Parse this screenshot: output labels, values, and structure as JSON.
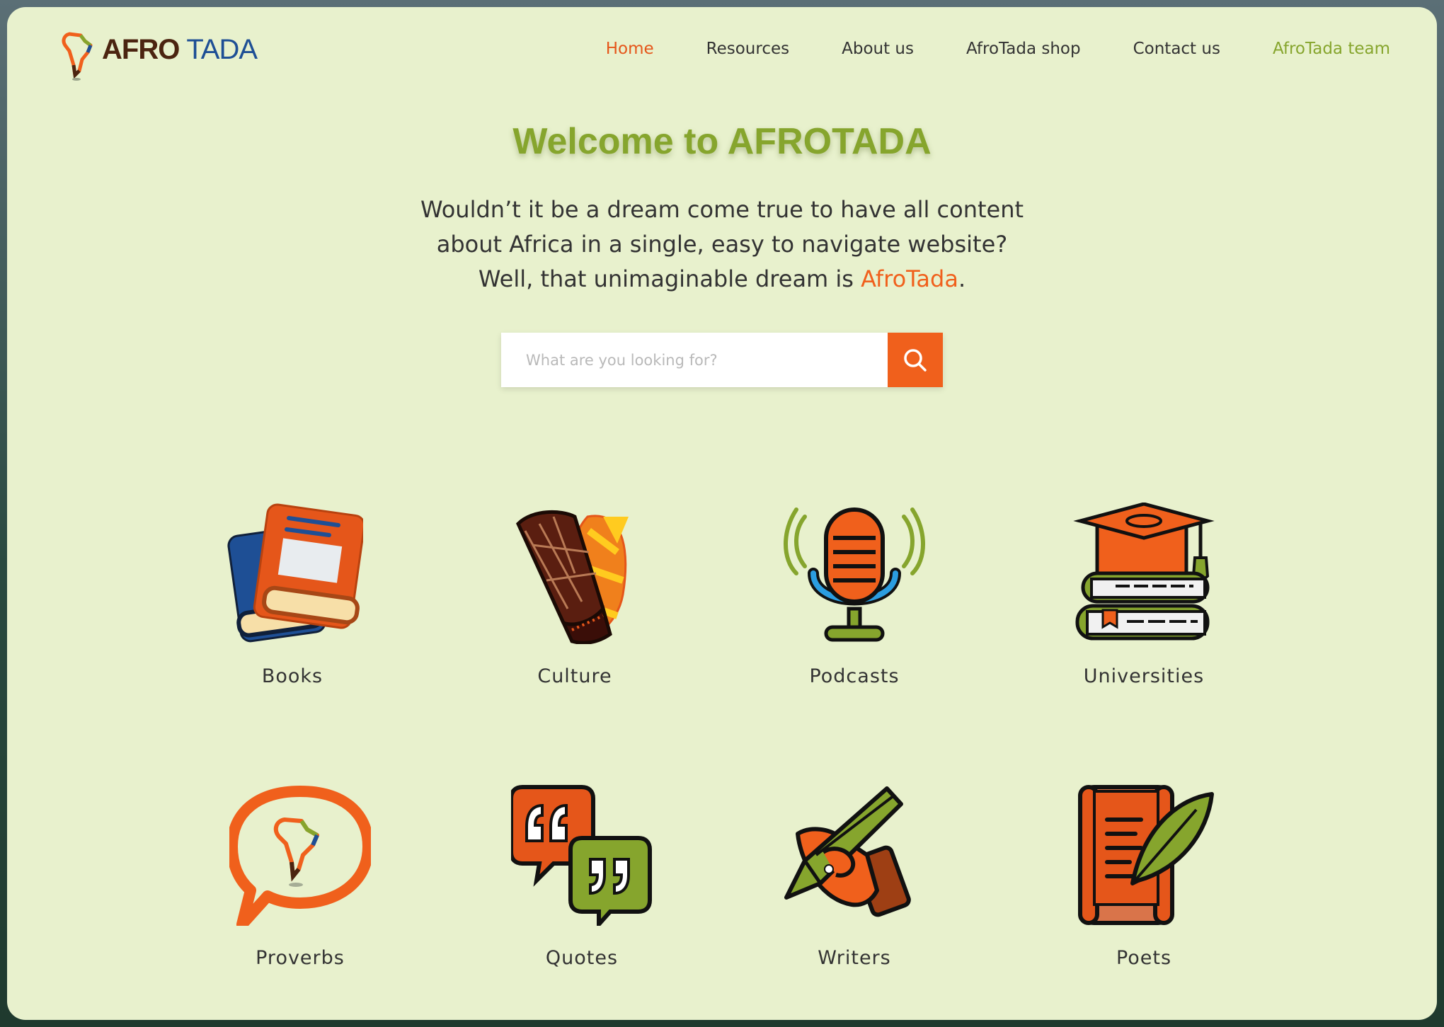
{
  "brand": {
    "logo_afro": "AFRO",
    "logo_tada": "TADA"
  },
  "nav": {
    "items": [
      {
        "label": "Home",
        "state": "active"
      },
      {
        "label": "Resources",
        "state": "normal"
      },
      {
        "label": "About us",
        "state": "normal"
      },
      {
        "label": "AfroTada shop",
        "state": "normal"
      },
      {
        "label": "Contact us",
        "state": "normal"
      },
      {
        "label": "AfroTada team",
        "state": "highlight"
      }
    ]
  },
  "hero": {
    "title": "Welcome to AFROTADA",
    "line1": "Wouldn’t it be a dream come true to have all content",
    "line2": "about Africa in a single, easy to navigate website?",
    "line3_prefix": "Well, that unimaginable dream is ",
    "line3_brand": "AfroTada",
    "line3_suffix": "."
  },
  "search": {
    "placeholder": "What are you looking for?",
    "value": "",
    "button_icon": "search-icon"
  },
  "categories": [
    {
      "label": "Books",
      "icon": "books-icon"
    },
    {
      "label": "Culture",
      "icon": "drum-icon"
    },
    {
      "label": "Podcasts",
      "icon": "microphone-icon"
    },
    {
      "label": "Universities",
      "icon": "graduation-cap-icon"
    },
    {
      "label": "Proverbs",
      "icon": "speech-bubble-africa-icon"
    },
    {
      "label": "Quotes",
      "icon": "quote-bubbles-icon"
    },
    {
      "label": "Writers",
      "icon": "hand-pencil-icon"
    },
    {
      "label": "Poets",
      "icon": "scroll-quill-icon"
    }
  ],
  "colors": {
    "background": "#e8f1cd",
    "accent_orange": "#f0601c",
    "accent_green": "#86a52d",
    "text": "#333333",
    "logo_brown": "#4b2410",
    "logo_blue": "#1e4f95"
  }
}
